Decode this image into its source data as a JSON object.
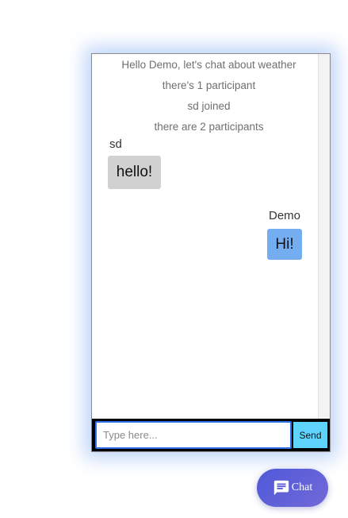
{
  "chat": {
    "system_messages": [
      "Hello Demo, let's chat about weather",
      "there's 1 participant",
      "sd joined",
      "there are 2 participants"
    ],
    "messages": [
      {
        "sender": "sd",
        "text": "hello!"
      },
      {
        "sender": "Demo",
        "text": "Hi!"
      }
    ]
  },
  "composer": {
    "placeholder": "Type here...",
    "value": "",
    "send_label": "Send"
  },
  "launcher": {
    "icon": "chat-bubble-icon",
    "label": "Chat"
  },
  "colors": {
    "bubble_other": "#d1d1d1",
    "bubble_me": "#75aef0",
    "send_button": "#5ed3fb",
    "launcher_gradient_start": "#4f59d9",
    "launcher_gradient_end": "#7269d8"
  }
}
